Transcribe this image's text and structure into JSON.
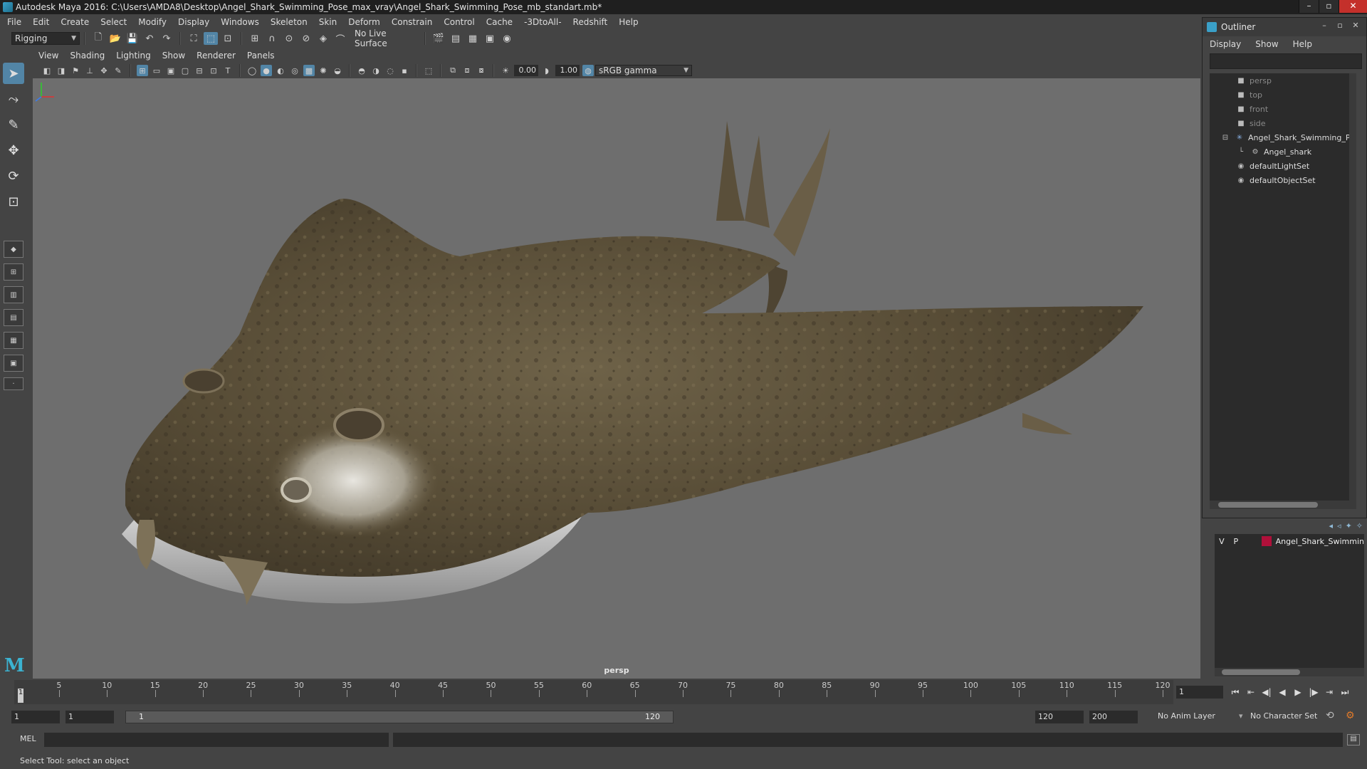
{
  "window": {
    "title": "Autodesk Maya 2016: C:\\Users\\AMDA8\\Desktop\\Angel_Shark_Swimming_Pose_max_vray\\Angel_Shark_Swimming_Pose_mb_standart.mb*",
    "minimize": "–",
    "maximize": "▫",
    "close": "✕"
  },
  "menubar": [
    "File",
    "Edit",
    "Create",
    "Select",
    "Modify",
    "Display",
    "Windows",
    "Skeleton",
    "Skin",
    "Deform",
    "Constrain",
    "Control",
    "Cache",
    "-3DtoAll-",
    "Redshift",
    "Help"
  ],
  "statusline": {
    "mode": "Rigging",
    "live_surface": "No Live Surface"
  },
  "viewport_menu": [
    "View",
    "Shading",
    "Lighting",
    "Show",
    "Renderer",
    "Panels"
  ],
  "viewport_toolbar": {
    "exposure": "0.00",
    "gamma": "1.00",
    "color_space": "sRGB gamma"
  },
  "viewport": {
    "camera_label": "persp"
  },
  "outliner": {
    "title": "Outliner",
    "menu": [
      "Display",
      "Show",
      "Help"
    ],
    "items": [
      {
        "label": "persp",
        "dim": true,
        "icon": "camera-icon"
      },
      {
        "label": "top",
        "dim": true,
        "icon": "camera-icon"
      },
      {
        "label": "front",
        "dim": true,
        "icon": "camera-icon"
      },
      {
        "label": "side",
        "dim": true,
        "icon": "camera-icon"
      },
      {
        "label": "Angel_Shark_Swimming_Po",
        "dim": false,
        "icon": "joint-icon"
      },
      {
        "label": "Angel_shark",
        "dim": false,
        "icon": "mesh-icon"
      },
      {
        "label": "defaultLightSet",
        "dim": false,
        "icon": "set-icon"
      },
      {
        "label": "defaultObjectSet",
        "dim": false,
        "icon": "set-icon"
      }
    ]
  },
  "layers": {
    "row": {
      "v": "V",
      "p": "P",
      "name": "Angel_Shark_Swimmin",
      "color": "#b0103a"
    }
  },
  "timeline": {
    "ticks": [
      "5",
      "10",
      "15",
      "20",
      "25",
      "30",
      "35",
      "40",
      "45",
      "50",
      "55",
      "60",
      "65",
      "70",
      "75",
      "80",
      "85",
      "90",
      "95",
      "100",
      "105",
      "110",
      "115",
      "120"
    ],
    "playhead": "1",
    "current_frame": "1"
  },
  "range": {
    "start": "1",
    "playback_start": "1",
    "bar_left": "1",
    "bar_right": "120",
    "playback_end": "120",
    "end": "200",
    "anim_layer": "No Anim Layer",
    "char_set": "No Character Set"
  },
  "cmdline": {
    "label": "MEL"
  },
  "helpline": {
    "text": "Select Tool: select an object"
  }
}
